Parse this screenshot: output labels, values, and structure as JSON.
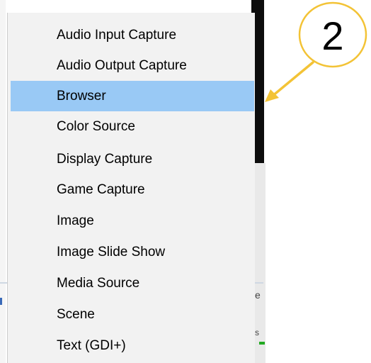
{
  "menu": {
    "items": [
      {
        "label": "Audio Input Capture",
        "highlighted": false
      },
      {
        "label": "Audio Output Capture",
        "highlighted": false
      },
      {
        "label": "Browser",
        "highlighted": true
      },
      {
        "label": "Color Source",
        "highlighted": false
      },
      {
        "label": "Display Capture",
        "highlighted": false
      },
      {
        "label": "Game Capture",
        "highlighted": false
      },
      {
        "label": "Image",
        "highlighted": false
      },
      {
        "label": "Image Slide Show",
        "highlighted": false
      },
      {
        "label": "Media Source",
        "highlighted": false
      },
      {
        "label": "Scene",
        "highlighted": false
      },
      {
        "label": "Text (GDI+)",
        "highlighted": false
      }
    ]
  },
  "callout": {
    "number": "2",
    "color": "#f3c336"
  },
  "background_fragments": {
    "edge_char_1": "e",
    "edge_char_2": "s"
  },
  "colors": {
    "highlight": "#99c9f5",
    "menu_bg": "#f2f2f2"
  }
}
